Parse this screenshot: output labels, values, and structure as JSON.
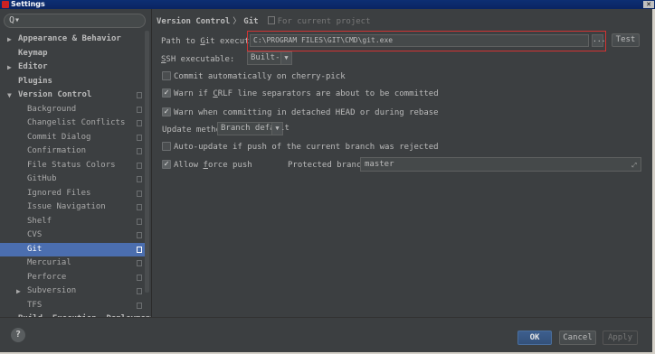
{
  "window": {
    "title": "Settings",
    "close_glyph": "✕"
  },
  "sidebar": {
    "search_placeholder": "",
    "search_icon": "search-icon",
    "items": [
      {
        "label": "Appearance & Behavior",
        "level": 0,
        "arrow": "▶",
        "project": false
      },
      {
        "label": "Keymap",
        "level": 0,
        "arrow": "",
        "project": false
      },
      {
        "label": "Editor",
        "level": 0,
        "arrow": "▶",
        "project": false
      },
      {
        "label": "Plugins",
        "level": 0,
        "arrow": "",
        "project": false
      },
      {
        "label": "Version Control",
        "level": 0,
        "arrow": "▼",
        "project": true
      },
      {
        "label": "Background",
        "level": 1,
        "project": true
      },
      {
        "label": "Changelist Conflicts",
        "level": 1,
        "project": true
      },
      {
        "label": "Commit Dialog",
        "level": 1,
        "project": true
      },
      {
        "label": "Confirmation",
        "level": 1,
        "project": true
      },
      {
        "label": "File Status Colors",
        "level": 1,
        "project": true
      },
      {
        "label": "GitHub",
        "level": 1,
        "project": true
      },
      {
        "label": "Ignored Files",
        "level": 1,
        "project": true
      },
      {
        "label": "Issue Navigation",
        "level": 1,
        "project": true
      },
      {
        "label": "Shelf",
        "level": 1,
        "project": true
      },
      {
        "label": "CVS",
        "level": 1,
        "project": true
      },
      {
        "label": "Git",
        "level": 1,
        "project": true,
        "selected": true
      },
      {
        "label": "Mercurial",
        "level": 1,
        "project": true
      },
      {
        "label": "Perforce",
        "level": 1,
        "project": true
      },
      {
        "label": "Subversion",
        "level": 1,
        "arrow": "▶",
        "project": true
      },
      {
        "label": "TFS",
        "level": 1,
        "project": true
      },
      {
        "label": "Build, Execution, Deployment",
        "level": 0,
        "arrow": "▶",
        "project": false
      }
    ]
  },
  "breadcrumb": {
    "section": "Version Control",
    "separator": "〉",
    "page": "Git",
    "scope": "For current project"
  },
  "git": {
    "path_label_prefix": "Path to ",
    "path_label_mnemonic": "G",
    "path_label_suffix": "it executable:",
    "path_value": "C:\\PROGRAM FILES\\GIT\\CMD\\git.exe",
    "browse_label": "...",
    "test_label": "Test",
    "ssh_label_mnemonic": "S",
    "ssh_label_suffix": "SH executable:",
    "ssh_value": "Built-in",
    "commit_cherry_pick_label": "Commit automatically on cherry-pick",
    "commit_cherry_pick_checked": false,
    "warn_crlf_prefix": "Warn if ",
    "warn_crlf_mnemonic": "C",
    "warn_crlf_suffix": "RLF line separators are about to be committed",
    "warn_crlf_checked": true,
    "warn_detached_label": "Warn when committing in detached HEAD or during rebase",
    "warn_detached_checked": true,
    "update_method_label": "Update method:",
    "update_method_value": "Branch default",
    "auto_update_label": "Auto-update if push of the current branch was rejected",
    "auto_update_checked": false,
    "allow_force_prefix": "Allow ",
    "allow_force_mnemonic": "f",
    "allow_force_suffix": "orce push",
    "allow_force_checked": true,
    "protected_label": "Protected branches:",
    "protected_value": "master"
  },
  "buttons": {
    "help": "?",
    "ok": "OK",
    "cancel": "Cancel",
    "apply": "Apply"
  },
  "colors": {
    "selection": "#4b6eaf",
    "highlight_border": "#d23333",
    "background": "#3c3f41"
  }
}
